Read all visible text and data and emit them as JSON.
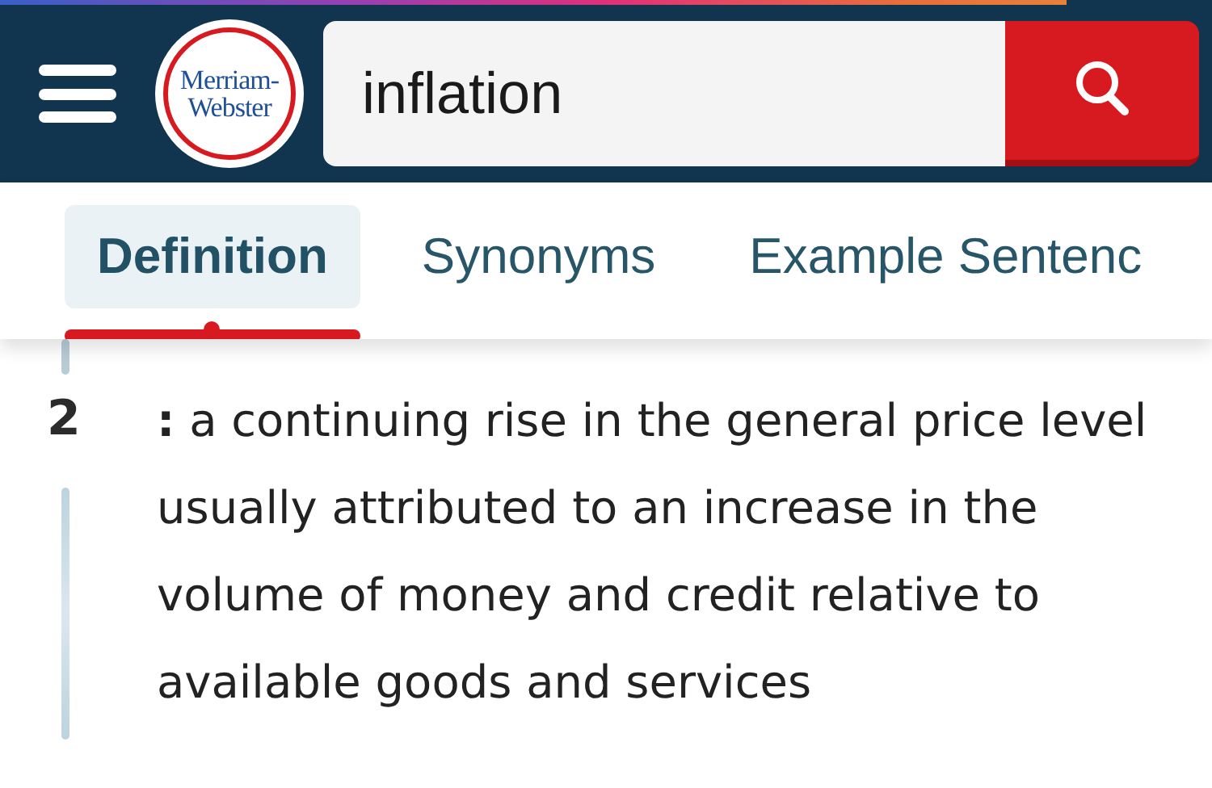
{
  "header": {
    "logo": "Merriam-Webster",
    "search": {
      "value": "inflation"
    }
  },
  "tabs": [
    {
      "label": "Definition",
      "selected": true
    },
    {
      "label": "Synonyms",
      "selected": false
    },
    {
      "label": "Example Sentenc",
      "selected": false
    }
  ],
  "definition": {
    "number": "2",
    "text": "**:** a continuing rise in the general price level usually attributed to an increase in the volume of money and credit relative to available goods and services"
  }
}
